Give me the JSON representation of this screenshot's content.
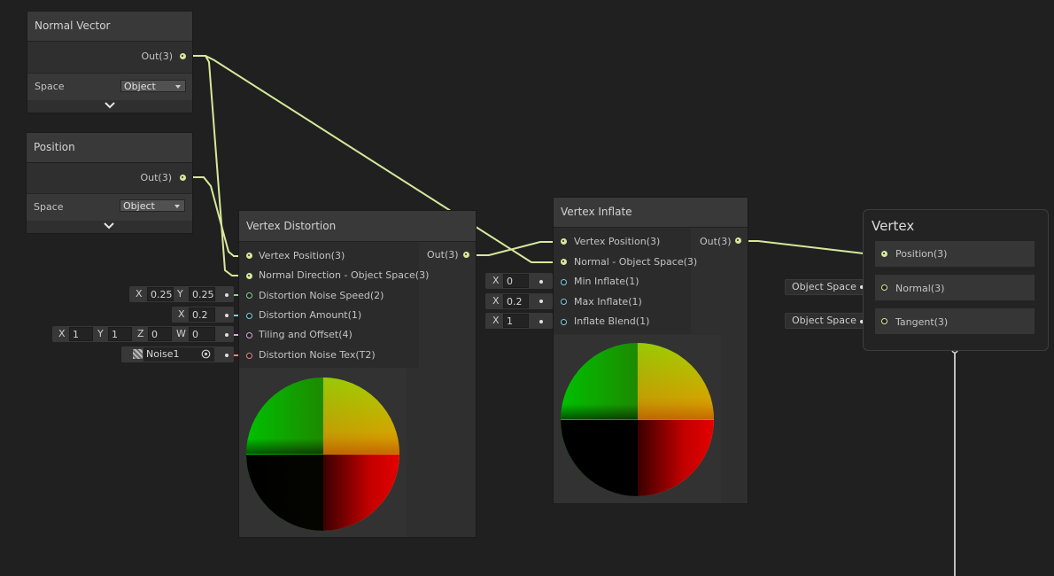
{
  "colors": {
    "background": "#202020",
    "node": "#2f2f2f",
    "node_title": "#393939",
    "wire_vector3": "#d8e89a",
    "port_float": "#7ccde0",
    "port_vector2": "#8fd18c",
    "port_vector4": "#d7a9db",
    "port_texture": "#e88484"
  },
  "normal_vector_node": {
    "title": "Normal Vector",
    "output": "Out(3)",
    "space_label": "Space",
    "space_value": "Object",
    "expand_icon": "chevron-down-icon"
  },
  "position_node": {
    "title": "Position",
    "output": "Out(3)",
    "space_label": "Space",
    "space_value": "Object",
    "expand_icon": "chevron-down-icon"
  },
  "vertex_distortion_node": {
    "title": "Vertex Distortion",
    "output": "Out(3)",
    "inputs": [
      "Vertex Position(3)",
      "Normal Direction - Object Space(3)",
      "Distortion Noise Speed(2)",
      "Distortion Amount(1)",
      "Tiling and Offset(4)",
      "Distortion Noise Tex(T2)"
    ],
    "noise_speed": {
      "x_label": "X",
      "x": "0.25",
      "y_label": "Y",
      "y": "0.25"
    },
    "amount": {
      "x_label": "X",
      "x": "0.2"
    },
    "tiling": {
      "x_label": "X",
      "x": "1",
      "y_label": "Y",
      "y": "1",
      "z_label": "Z",
      "z": "0",
      "w_label": "W",
      "w": "0"
    },
    "texture": {
      "name": "Noise1",
      "icon": "texture-thumbnail-icon",
      "picker_icon": "object-picker-icon"
    }
  },
  "vertex_inflate_node": {
    "title": "Vertex Inflate",
    "output": "Out(3)",
    "inputs": [
      "Vertex Position(3)",
      "Normal - Object Space(3)",
      "Min Inflate(1)",
      "Max Inflate(1)",
      "Inflate Blend(1)"
    ],
    "min_inflate": {
      "x_label": "X",
      "x": "0"
    },
    "max_inflate": {
      "x_label": "X",
      "x": "0.2"
    },
    "inflate_blend": {
      "x_label": "X",
      "x": "1"
    }
  },
  "vertex_context": {
    "title": "Vertex",
    "slots": [
      "Position(3)",
      "Normal(3)",
      "Tangent(3)"
    ],
    "normal_default": "Object Space",
    "tangent_default": "Object Space"
  }
}
